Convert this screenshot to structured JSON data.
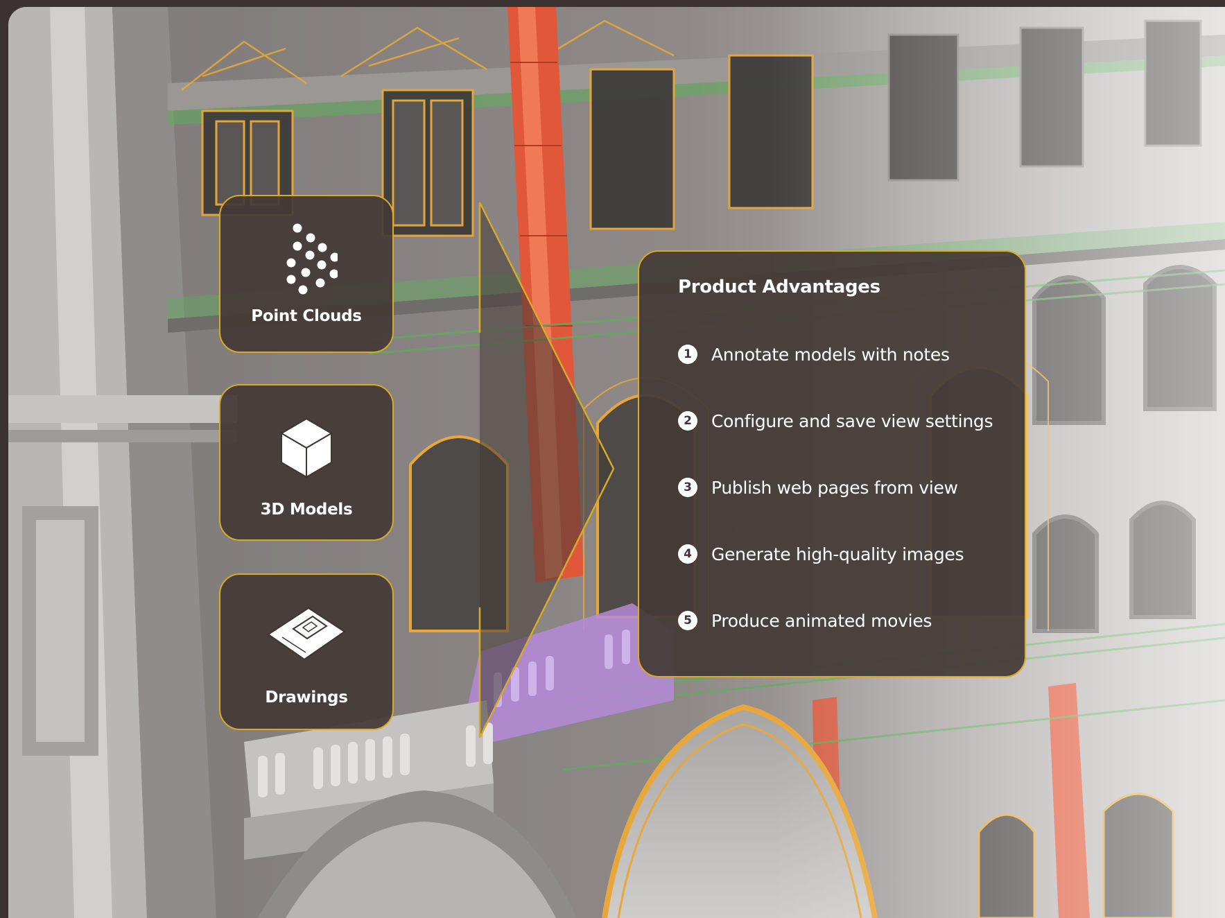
{
  "cards": [
    {
      "label": "Point Clouds",
      "icon": "point-cloud-icon"
    },
    {
      "label": "3D Models",
      "icon": "cube-icon"
    },
    {
      "label": "Drawings",
      "icon": "drawing-sheet-icon"
    }
  ],
  "panel": {
    "title": "Product Advantages",
    "items": [
      {
        "number": "1",
        "text": "Annotate models with notes"
      },
      {
        "number": "2",
        "text": "Configure and save view settings"
      },
      {
        "number": "3",
        "text": "Publish web pages from view"
      },
      {
        "number": "4",
        "text": "Generate high-quality images"
      },
      {
        "number": "5",
        "text": "Produce animated movies"
      }
    ]
  },
  "colors": {
    "accent": "#d9a928",
    "panel_bg": "#443a37",
    "frame_bg": "#3a3331",
    "wireframe_orange": "#e7a73a",
    "wireframe_green": "#5fae5a",
    "column_red": "#e0573a",
    "balustrade_purple": "#b48ad8"
  },
  "background_image": "building-facade-point-cloud-bim-render"
}
